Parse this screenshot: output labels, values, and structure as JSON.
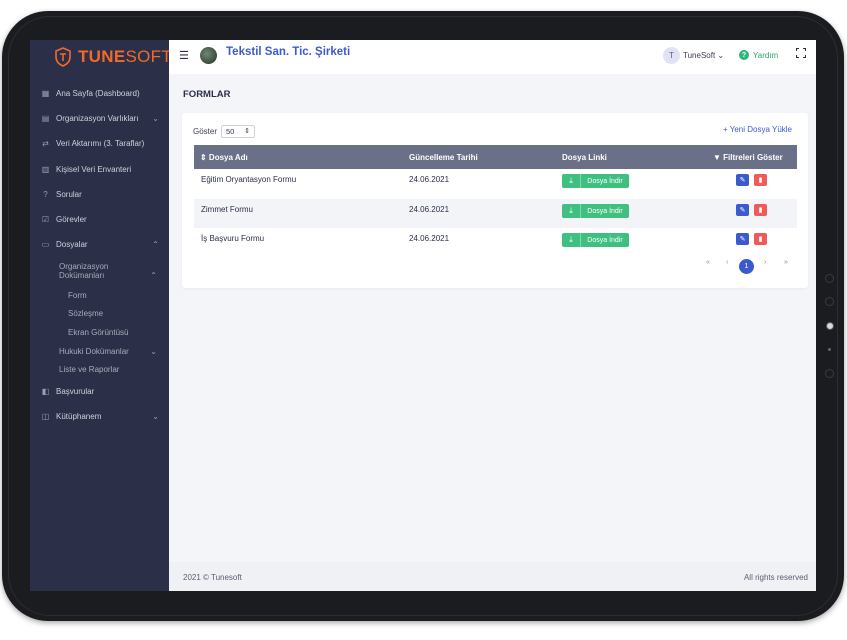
{
  "brand": {
    "part1": "TUNE",
    "part2": "SOFT"
  },
  "header": {
    "menu_icon": "hamburger-icon",
    "company": "Tekstil San. Tic. Şirketi",
    "user_initial": "T",
    "user_name": "TuneSoft",
    "help_label": "Yardım",
    "help_icon": "?"
  },
  "sidebar": {
    "items": [
      {
        "label": "Ana Sayfa (Dashboard)",
        "icon": "▦"
      },
      {
        "label": "Organizasyon Varlıkları",
        "icon": "▤",
        "chevron": "⌄"
      },
      {
        "label": "Veri Aktarımı (3. Taraflar)",
        "icon": "⇄"
      },
      {
        "label": "Kişisel Veri Envanteri",
        "icon": "▥"
      },
      {
        "label": "Sorular",
        "icon": "?"
      },
      {
        "label": "Görevler",
        "icon": "☑"
      },
      {
        "label": "Dosyalar",
        "icon": "▭",
        "chevron": "⌃"
      },
      {
        "label": "Başvurular",
        "icon": "◧"
      },
      {
        "label": "Kütüphanem",
        "icon": "◫",
        "chevron": "⌄"
      }
    ],
    "subitems": {
      "org_docs_line1": "Organizasyon",
      "org_docs_line2": "Dokümanları",
      "org_docs_chevron": "⌃",
      "form": "Form",
      "contract": "Sözleşme",
      "screenshot": "Ekran Görüntüsü",
      "legal_docs": "Hukuki Dokümanlar",
      "legal_chevron": "⌄",
      "reports": "Liste ve Raporlar"
    }
  },
  "page": {
    "title": "FORMLAR"
  },
  "table_controls": {
    "show_label": "Göster",
    "page_size": "50",
    "new_upload": "+ Yeni Dosya Yükle"
  },
  "table": {
    "headers": {
      "name": "⇕ Dosya Adı",
      "updated": "Güncelleme Tarihi",
      "link": "Dosya Linki",
      "filters": "Filtreleri Göster"
    },
    "rows": [
      {
        "name": "Eğitim Oryantasyon Formu",
        "date": "24.06.2021",
        "download": "Dosya İndir"
      },
      {
        "name": "Zimmet Formu",
        "date": "24.06.2021",
        "download": "Dosya İndir"
      },
      {
        "name": "İş Başvuru Formu",
        "date": "24.06.2021",
        "download": "Dosya İndir"
      }
    ]
  },
  "pagination": {
    "first": "«",
    "prev": "‹",
    "current": "1",
    "next": "›",
    "last": "»"
  },
  "footer": {
    "copyright": "2021 © Tunesoft",
    "rights": "All rights reserved"
  },
  "colors": {
    "sidebar_bg": "#2b2f47",
    "accent_blue": "#3b5bcc",
    "brand_orange": "#f06a2c",
    "download_green": "#3fbf80",
    "delete_red": "#ef5a5a",
    "table_header": "#6b7089"
  }
}
